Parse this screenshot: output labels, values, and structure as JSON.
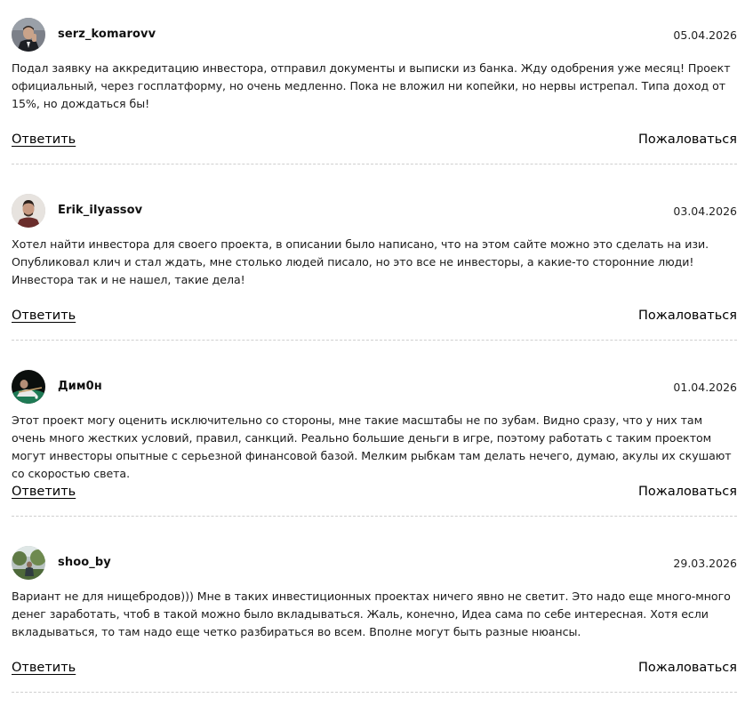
{
  "comments": [
    {
      "username": "serz_komarovv",
      "date": "05.04.2026",
      "avatar": "avatar-man-in-suit",
      "text": "Подал заявку на аккредитацию инвестора, отправил документы и выписки из банка. Жду одобрения уже месяц! Проект официальный, через госплатформу, но очень медленно. Пока не вложил ни копейки, но нервы истрепал. Типа доход от 15%, но дождаться бы!",
      "reply_label": "Ответить",
      "complain_label": "Пожаловаться"
    },
    {
      "username": "Erik_ilyassov",
      "date": "03.04.2026",
      "avatar": "avatar-young-man",
      "text": "Хотел найти инвестора для своего проекта, в описании было написано, что на этом сайте можно это сделать на изи. Опубликовал клич и стал ждать, мне столько людей писало, но это все не инвесторы, а какие-то сторонние люди! Инвестора так и не нашел, такие дела!",
      "reply_label": "Ответить",
      "complain_label": "Пожаловаться"
    },
    {
      "username": "Дим0н",
      "date": "01.04.2026",
      "avatar": "avatar-billiards",
      "text": "Этот проект могу оценить исключительно со стороны, мне такие масштабы не по зубам. Видно сразу, что у них там очень много жестких условий, правил, санкций. Реально большие деньги в игре, поэтому работать с таким проектом могут инвесторы опытные с серьезной финансовой базой. Мелким рыбкам там делать нечего, думаю, акулы их скушают со скоростью света.",
      "reply_label": "Ответить",
      "complain_label": "Пожаловаться"
    },
    {
      "username": "shoo_by",
      "date": "29.03.2026",
      "avatar": "avatar-outdoor",
      "text": "Вариант не для нищебродов))) Мне в таких инвестиционных проектах ничего явно не светит. Это надо еще много-много денег заработать, чтоб в такой можно было вкладываться. Жаль, конечно, Идеа сама по себе интересная. Хотя если вкладываться, то там надо еще четко разбираться во всем. Вполне могут быть разные нюансы.",
      "reply_label": "Ответить",
      "complain_label": "Пожаловаться"
    }
  ]
}
